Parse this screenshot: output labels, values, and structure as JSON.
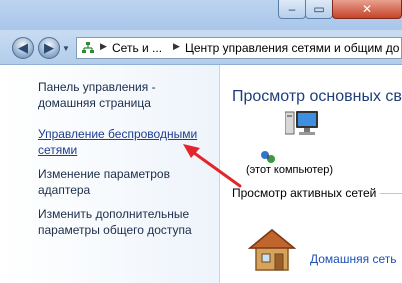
{
  "address_bar": {
    "segment1": "Сеть и ...",
    "segment2": "Центр управления сетями и общим до"
  },
  "sidebar": {
    "items": [
      {
        "label": "Панель управления - домашняя страница"
      },
      {
        "label": "Управление беспроводными сетями"
      },
      {
        "label": "Изменение параметров адаптера"
      },
      {
        "label": "Изменить дополнительные параметры общего доступа"
      }
    ]
  },
  "main": {
    "heading": "Просмотр основных све",
    "computer_label": "(этот компьютер)",
    "active_networks_label": "Просмотр активных сетей",
    "network_name": "Домашняя сеть"
  },
  "colors": {
    "link": "#1e3d8f",
    "heading": "#1e3f7a",
    "arrow": "#e3262b"
  }
}
